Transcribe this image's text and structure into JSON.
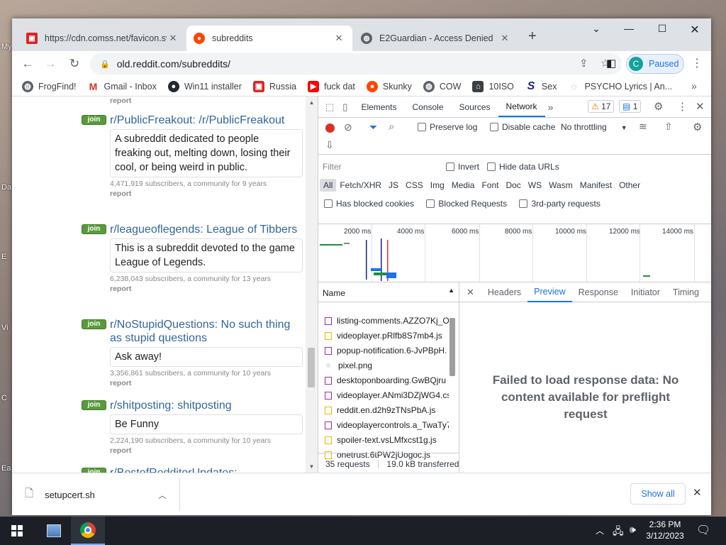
{
  "browser": {
    "tabs": [
      {
        "title": "https://cdn.comss.net/favicon.sv",
        "active": false
      },
      {
        "title": "subreddits",
        "active": true
      },
      {
        "title": "E2Guardian - Access Denied",
        "active": false
      }
    ],
    "url": "old.reddit.com/subreddits/",
    "profile_initial": "C",
    "profile_label": "Paused",
    "bookmarks": [
      "FrogFind!",
      "Gmail - Inbox",
      "Win11 installer",
      "Russia",
      "fuck dat",
      "Skunky",
      "COW",
      "10ISO",
      "Sex",
      "PSYCHO Lyrics | An..."
    ]
  },
  "page": {
    "top_report": "report",
    "join_label": "join",
    "subreddits": [
      {
        "name": "r/PublicFreakout: /r/PublicFreakout",
        "desc": "A subreddit dedicated to people freaking out, melting down, losing their cool, or being weird in public.",
        "meta": "4,471,919 subscribers, a community for 9 years",
        "report": "report"
      },
      {
        "name": "r/leagueoflegends: League of Tibbers",
        "desc": "This is a subreddit devoted to the game League of Legends.",
        "meta": "6,238,043 subscribers, a community for 13 years",
        "report": "report"
      },
      {
        "name": "r/NoStupidQuestions: No such thing as stupid questions",
        "desc": "Ask away!",
        "meta": "3,356,861 subscribers, a community for 10 years",
        "report": "report"
      },
      {
        "name": "r/shitposting: shitposting",
        "desc": "Be Funny",
        "meta": "2,224,190 subscribers, a community for 10 years",
        "report": "report"
      },
      {
        "name": "r/BestofRedditorUpdates:",
        "desc": "",
        "meta": "",
        "report": ""
      }
    ]
  },
  "devtools": {
    "tabs": [
      "Elements",
      "Console",
      "Sources",
      "Network"
    ],
    "more": "»",
    "warnings": "17",
    "messages": "1",
    "preserve_log": "Preserve log",
    "disable_cache": "Disable cache",
    "throttling": "No throttling",
    "filter_placeholder": "Filter",
    "invert": "Invert",
    "hide_data_urls": "Hide data URLs",
    "filter_types": [
      "All",
      "Fetch/XHR",
      "JS",
      "CSS",
      "Img",
      "Media",
      "Font",
      "Doc",
      "WS",
      "Wasm",
      "Manifest",
      "Other"
    ],
    "has_blocked_cookies": "Has blocked cookies",
    "blocked_requests": "Blocked Requests",
    "third_party": "3rd-party requests",
    "timeline_ticks": [
      "2000 ms",
      "4000 ms",
      "6000 ms",
      "8000 ms",
      "10000 ms",
      "12000 ms",
      "14000 ms"
    ],
    "name_header": "Name",
    "requests": [
      {
        "name": "listing-comments.AZZO7Kj_O",
        "kind": "css"
      },
      {
        "name": "videoplayer.pRlfb8S7mb4.js",
        "kind": "js"
      },
      {
        "name": "popup-notification.6-JvPBpH.",
        "kind": "css"
      },
      {
        "name": "pixel.png",
        "kind": "img"
      },
      {
        "name": "desktoponboarding.GwBQjru",
        "kind": "css"
      },
      {
        "name": "videoplayer.ANmi3DZjWG4.cs",
        "kind": "css"
      },
      {
        "name": "reddit.en.d2h9zTNsPbA.js",
        "kind": "js"
      },
      {
        "name": "videoplayercontrols.a_TwaTy7",
        "kind": "css"
      },
      {
        "name": "spoiler-text.vsLMfxcst1g.js",
        "kind": "js"
      },
      {
        "name": "onetrust.6tPW2jUogoc.js",
        "kind": "js"
      }
    ],
    "request_count": "35 requests",
    "transferred": "19.0 kB transferred",
    "detail_tabs": [
      "Headers",
      "Preview",
      "Response",
      "Initiator",
      "Timing"
    ],
    "preview_message": "Failed to load response data: No content available for preflight request"
  },
  "downloads": {
    "file": "setupcert.sh",
    "show_all": "Show all"
  },
  "taskbar": {
    "time": "2:36 PM",
    "date": "3/12/2023"
  },
  "desktop_labels": [
    "My",
    "Da",
    "E",
    "Vi",
    "C",
    "Ea"
  ]
}
